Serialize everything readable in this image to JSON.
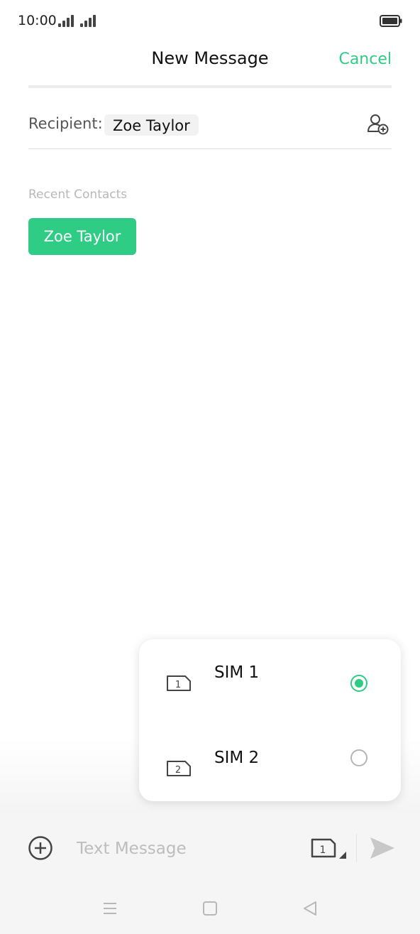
{
  "status_bar": {
    "time": "10:00",
    "icons": [
      "signal-icon",
      "signal-icon",
      "battery-icon"
    ]
  },
  "header": {
    "title": "New Message",
    "cancel_label": "Cancel"
  },
  "recipient": {
    "label": "Recipient:",
    "name": "Zoe Taylor",
    "add_icon": "add-contact-icon"
  },
  "recent_contacts": {
    "heading": "Recent Contacts",
    "items": [
      {
        "name": "Zoe Taylor"
      }
    ]
  },
  "sim_menu": {
    "options": [
      {
        "label": "SIM 1",
        "sim_number": "1",
        "selected": true
      },
      {
        "label": "SIM 2",
        "sim_number": "2",
        "selected": false
      }
    ]
  },
  "compose": {
    "placeholder": "Text Message",
    "value": "",
    "sim_number": "1",
    "icons": [
      "add-circle-icon",
      "sim-card-icon",
      "send-icon"
    ]
  },
  "navigation": {
    "icons": [
      "menu-icon",
      "home-icon",
      "back-icon"
    ]
  },
  "colors": {
    "accent": "#2ecc84",
    "background": "#ffffff",
    "bar_background": "#f5f5f5",
    "muted_text": "#b8b8b8"
  }
}
